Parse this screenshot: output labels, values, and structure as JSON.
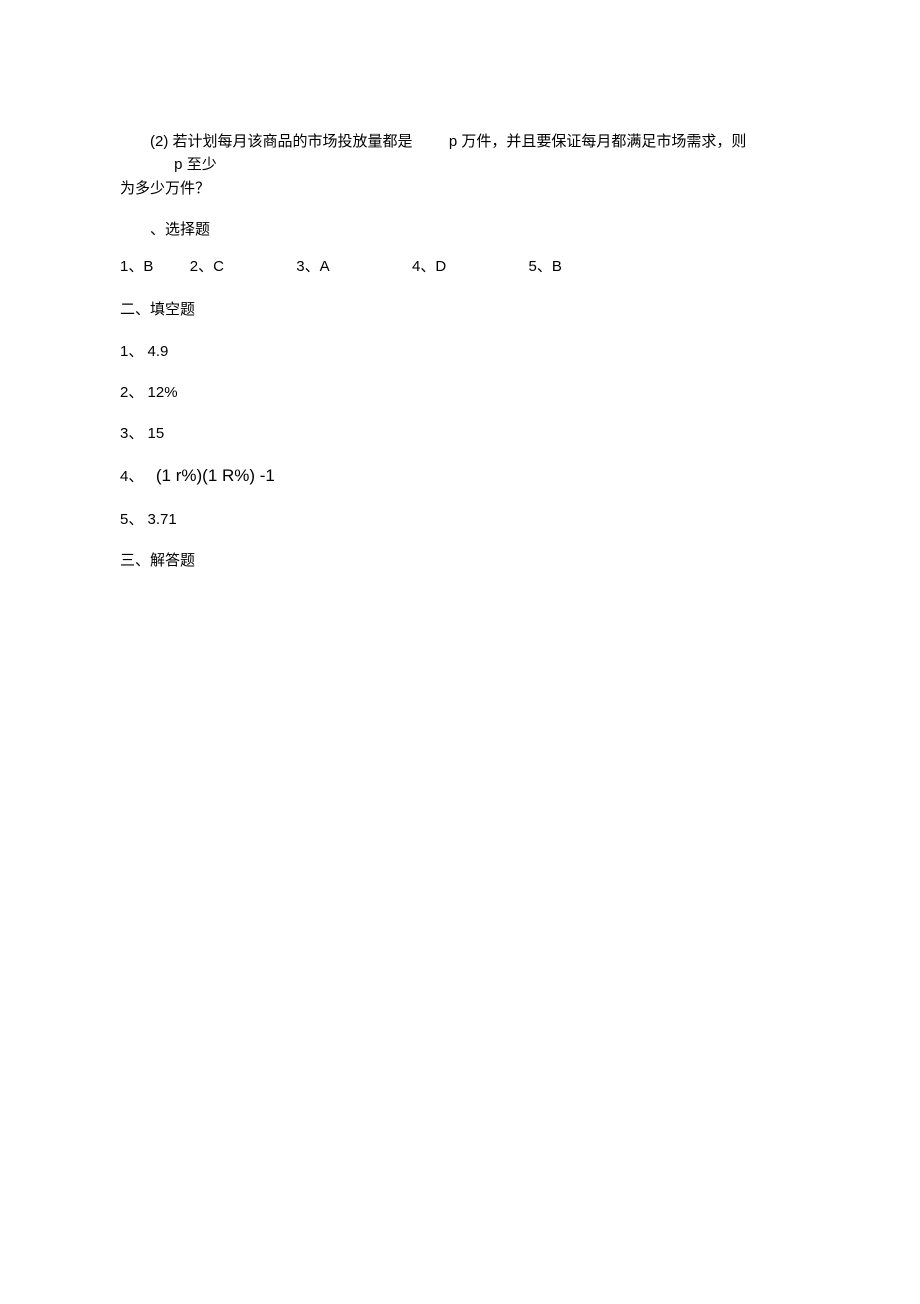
{
  "question": {
    "label": "(2)",
    "line1_a": "若计划每月该商品的市场投放量都是",
    "p1": "p",
    "line1_b": "万件，并且要保证每月都满足市场需求，则",
    "p2": "p",
    "line1_c": "至少",
    "line2": "为多少万件？"
  },
  "sections": {
    "mc_header": "、选择题",
    "fill_header": "二、填空题",
    "solve_header": "三、解答题"
  },
  "mc": [
    {
      "n": "1",
      "sep": "、",
      "ans": "B"
    },
    {
      "n": "2",
      "sep": "、",
      "ans": "C"
    },
    {
      "n": "3",
      "sep": "、",
      "ans": "A"
    },
    {
      "n": "4",
      "sep": "、",
      "ans": "D"
    },
    {
      "n": "5",
      "sep": "、",
      "ans": "B"
    }
  ],
  "fill": [
    {
      "n": "1",
      "sep": "、",
      "val": "4.9"
    },
    {
      "n": "2",
      "sep": "、",
      "val": "12%"
    },
    {
      "n": "3",
      "sep": "、",
      "val": "15"
    },
    {
      "n": "4",
      "sep": "、",
      "val": "(1 r%)(1 R%) -1"
    },
    {
      "n": "5",
      "sep": "、",
      "val": "3.71"
    }
  ]
}
